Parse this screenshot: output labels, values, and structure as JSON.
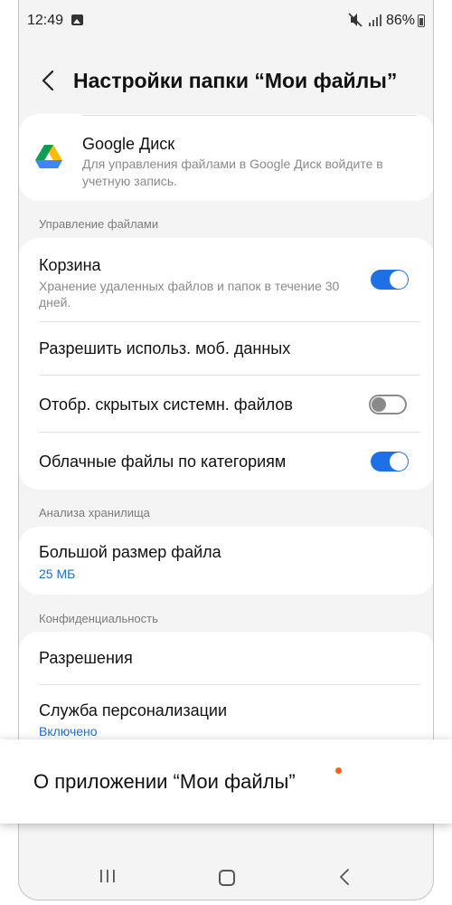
{
  "status_bar": {
    "time": "12:49",
    "battery": "86%",
    "icons": [
      "image-icon",
      "mute-icon",
      "signal-icon",
      "battery-icon"
    ]
  },
  "header": {
    "title": "Настройки папки “Мои файлы”",
    "back_icon": "chevron-left-icon"
  },
  "google_drive": {
    "title": "Google Диск",
    "description": "Для управления файлами в Google Диск войдите в учетную запись.",
    "icon": "google-drive-icon"
  },
  "file_management": {
    "section_label": "Управление файлами",
    "trash": {
      "title": "Корзина",
      "description": "Хранение удаленных файлов и папок в течение 30 дней.",
      "enabled": true
    },
    "mobile_data": {
      "title": "Разрешить использ. моб. данных"
    },
    "hidden_files": {
      "title": "Отобр. скрытых системн. файлов",
      "enabled": false
    },
    "cloud_by_category": {
      "title": "Облачные файлы по категориям",
      "enabled": true
    }
  },
  "storage_analysis": {
    "section_label": "Анализа хранилища",
    "large_file": {
      "title": "Большой размер файла",
      "value": "25 МБ"
    }
  },
  "privacy": {
    "section_label": "Конфиденциальность",
    "permissions": {
      "title": "Разрешения"
    },
    "personalization": {
      "title": "Служба персонализации",
      "status": "Включено"
    }
  },
  "about": {
    "label": "О приложении “Мои файлы”",
    "badge_color": "#f0641e"
  },
  "nav_bar": {
    "icons": [
      "recents-icon",
      "home-icon",
      "back-icon"
    ]
  },
  "colors": {
    "accent": "#1f6fe6",
    "link_text": "#1e6fd0",
    "background": "#f4f4f4",
    "card": "#ffffff"
  }
}
